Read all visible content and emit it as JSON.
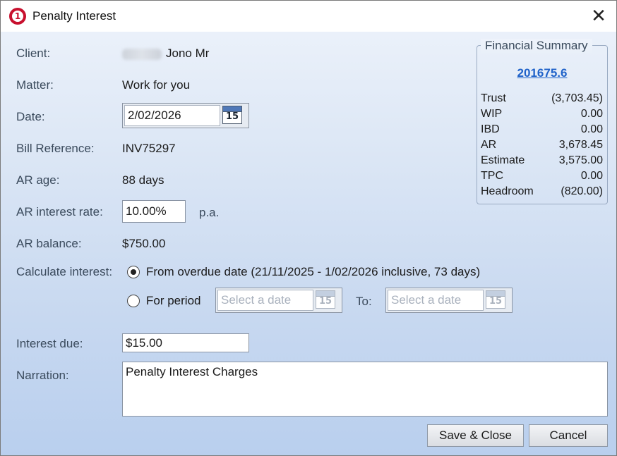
{
  "window": {
    "title": "Penalty Interest",
    "close_glyph": "✕"
  },
  "icons": {
    "app": "app-logo-icon",
    "calendar": "calendar-icon",
    "calendar_day": "15"
  },
  "form": {
    "client": {
      "label": "Client:",
      "value": "Jono Mr"
    },
    "matter": {
      "label": "Matter:",
      "value": "Work for you"
    },
    "date": {
      "label": "Date:",
      "value": "2/02/2026"
    },
    "bill_reference": {
      "label": "Bill Reference:",
      "value": "INV75297"
    },
    "ar_age": {
      "label": "AR age:",
      "value": "88 days"
    },
    "ar_interest_rate": {
      "label": "AR interest rate:",
      "value": "10.00%",
      "suffix": "p.a."
    },
    "ar_balance": {
      "label": "AR balance:",
      "value": "$750.00"
    },
    "calculate_interest": {
      "label": "Calculate interest:",
      "options": [
        {
          "label": "From overdue date (21/11/2025 - 1/02/2026 inclusive, 73 days)",
          "selected": true
        },
        {
          "label": "For period",
          "selected": false
        }
      ],
      "from_placeholder": "Select a date",
      "to_label": "To:",
      "to_placeholder": "Select a date"
    },
    "interest_due": {
      "label": "Interest due:",
      "value": "$15.00"
    },
    "narration": {
      "label": "Narration:",
      "value": "Penalty Interest Charges"
    }
  },
  "financial_summary": {
    "title": "Financial Summary",
    "account_link": "201675.6",
    "rows": [
      {
        "label": "Trust",
        "value": "(3,703.45)"
      },
      {
        "label": "WIP",
        "value": "0.00"
      },
      {
        "label": "IBD",
        "value": "0.00"
      },
      {
        "label": "AR",
        "value": "3,678.45"
      },
      {
        "label": "Estimate",
        "value": "3,575.00"
      },
      {
        "label": "TPC",
        "value": "0.00"
      },
      {
        "label": "Headroom",
        "value": "(820.00)"
      }
    ]
  },
  "buttons": {
    "save_close": "Save & Close",
    "cancel": "Cancel"
  },
  "colors": {
    "link": "#1f62c9",
    "logo": "#c8102e",
    "label": "#3a4a5c"
  }
}
